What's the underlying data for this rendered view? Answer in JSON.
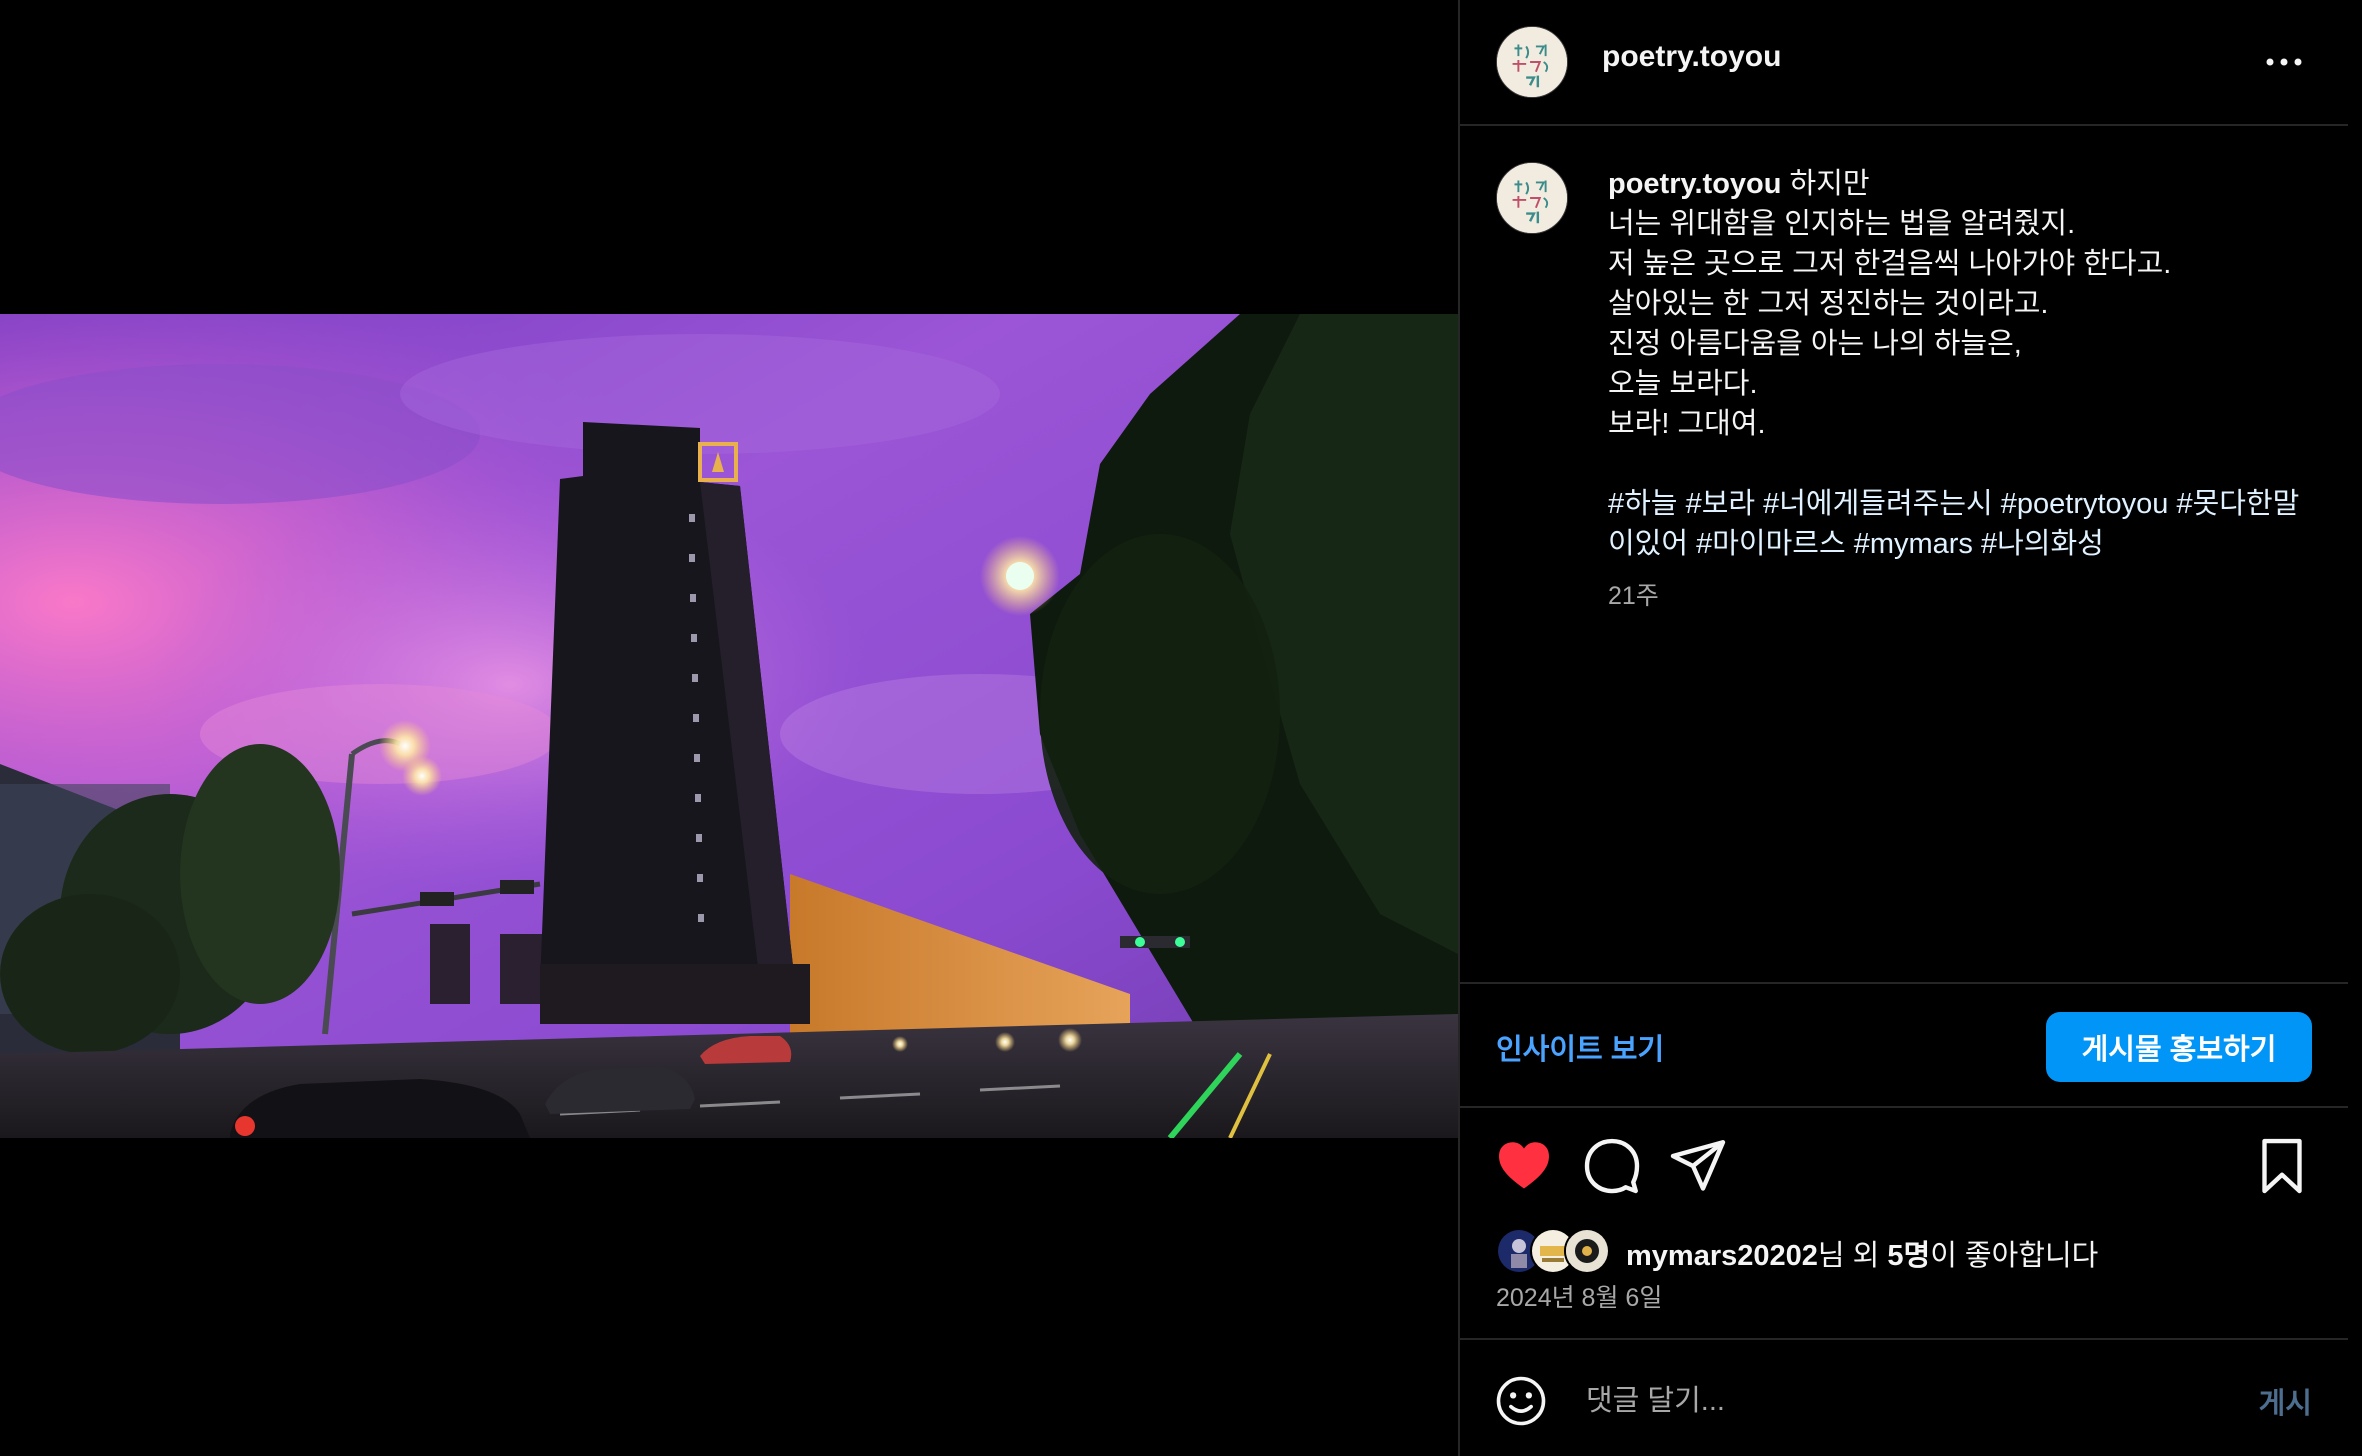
{
  "post": {
    "username": "poetry.toyou",
    "more_icon": "more-horizontal-icon",
    "caption": {
      "first_line": "하지만",
      "lines": [
        "너는 위대함을 인지하는 법을 알려줬지.",
        "저 높은 곳으로 그저 한걸음씩 나아가야 한다고.",
        "살아있는 한 그저 정진하는 것이라고.",
        "진정 아름다움을 아는 나의 하늘은,",
        "오늘 보라다.",
        "보라! 그대여."
      ],
      "hashtags": [
        "#하늘",
        "#보라",
        "#너에게들려주는시",
        "#poetrytoyou",
        "#못다한말이있어",
        "#마이마르스",
        "#mymars",
        "#나의화성"
      ]
    },
    "time_ago": "21주",
    "insights_label": "인사이트 보기",
    "promote_label": "게시물 홍보하기",
    "actions": {
      "like_icon": "heart-filled-icon",
      "comment_icon": "comment-icon",
      "share_icon": "paper-plane-icon",
      "save_icon": "bookmark-icon",
      "liked": true,
      "like_color": "#ff3040"
    },
    "likes": {
      "first_liker": "mymars20202",
      "suffix_1": "님 외 ",
      "others_count": "5명",
      "suffix_2": "이 좋아합니다"
    },
    "date": "2024년 8월 6일",
    "comment": {
      "placeholder": "댓글 달기...",
      "post_label": "게시"
    }
  },
  "colors": {
    "background": "#000000",
    "divider": "#262626",
    "link_blue": "#4aa3ff",
    "button_blue": "#0095f6",
    "muted_text": "#a8a8a8",
    "post_disabled": "#4d6e8e"
  }
}
